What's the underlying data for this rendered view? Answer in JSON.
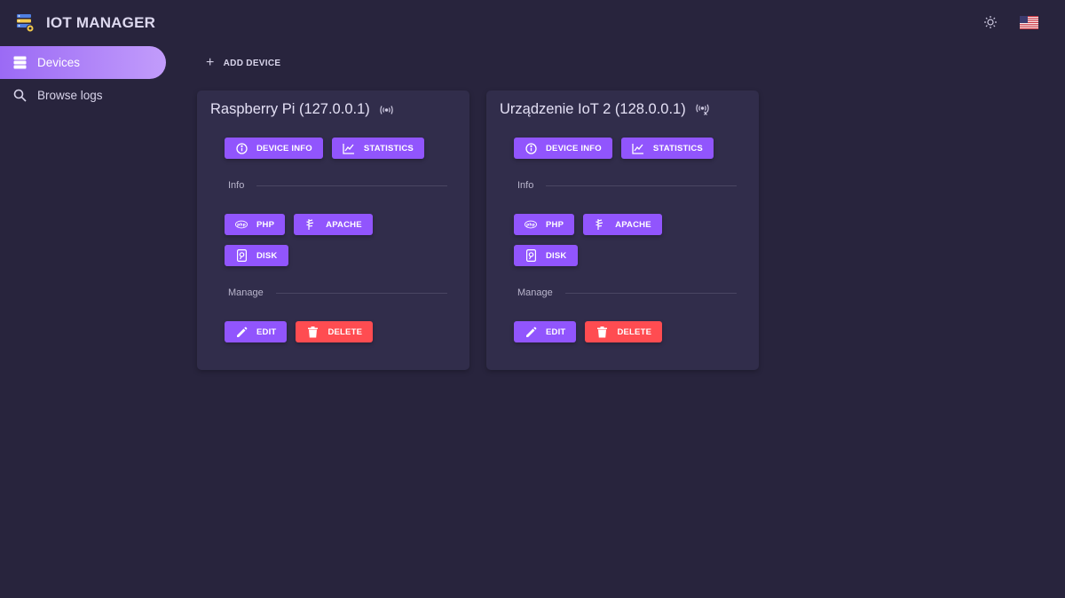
{
  "app": {
    "title": "IOT MANAGER"
  },
  "topbar": {
    "theme_icon": "sun-icon",
    "language_flag": "us-flag-icon"
  },
  "sidebar": {
    "items": [
      {
        "label": "Devices",
        "icon": "server-icon",
        "active": true
      },
      {
        "label": "Browse logs",
        "icon": "search-icon",
        "active": false
      }
    ]
  },
  "main": {
    "add_device_label": "ADD DEVICE"
  },
  "devices": [
    {
      "title": "Raspberry Pi (127.0.0.1)",
      "status_icon": "broadcast-signal-icon",
      "buttons": {
        "device_info": "DEVICE INFO",
        "statistics": "STATISTICS"
      },
      "info_section": "Info",
      "info_buttons": {
        "php": "PHP",
        "apache": "APACHE",
        "disk": "DISK"
      },
      "manage_section": "Manage",
      "manage_buttons": {
        "edit": "EDIT",
        "delete": "DELETE"
      }
    },
    {
      "title": "Urządzenie IoT 2 (128.0.0.1)",
      "status_icon": "broadcast-signal-off-icon",
      "buttons": {
        "device_info": "DEVICE INFO",
        "statistics": "STATISTICS"
      },
      "info_section": "Info",
      "info_buttons": {
        "php": "PHP",
        "apache": "APACHE",
        "disk": "DISK"
      },
      "manage_section": "Manage",
      "manage_buttons": {
        "edit": "EDIT",
        "delete": "DELETE"
      }
    }
  ],
  "colors": {
    "background": "#28243d",
    "card": "#312d4b",
    "primary": "#9155fd",
    "danger": "#ff4c51",
    "active_nav_start": "#9b6af5",
    "active_nav_end": "#c29cfb"
  }
}
